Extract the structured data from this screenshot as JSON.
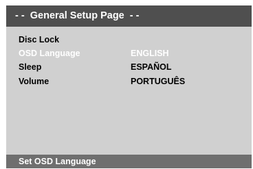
{
  "title": "- -  General Setup Page  - -",
  "menu": [
    {
      "label": "Disc Lock"
    },
    {
      "label": "OSD Language",
      "highlighted": true
    },
    {
      "label": "Sleep"
    },
    {
      "label": "Volume"
    }
  ],
  "options": [
    {
      "label": "ENGLISH",
      "highlighted": true
    },
    {
      "label": "ESPAÑOL"
    },
    {
      "label": "PORTUGUÊS"
    }
  ],
  "status": "Set OSD Language",
  "colors": {
    "background": "#d0d0d0",
    "title_bar": "#4f4f4f",
    "footer": "#6f6f6f",
    "highlight_text": "#ffffff"
  }
}
